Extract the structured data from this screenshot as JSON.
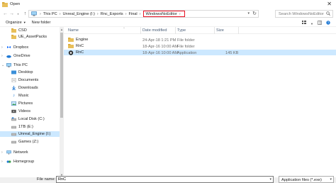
{
  "window": {
    "title": "Open"
  },
  "address": {
    "crumbs": [
      "This PC",
      "Unreal_Engine (I:)",
      "Rnc_Exports",
      "Final"
    ],
    "current": "WindowsNoEditor"
  },
  "search": {
    "placeholder": "Search WindowsNoEditor"
  },
  "toolbar": {
    "organize": "Organize",
    "new_folder": "New folder"
  },
  "sidebar": {
    "items": [
      {
        "label": "CSD",
        "icon": "folder-icon"
      },
      {
        "label": "UE_AssetPacks",
        "icon": "folder-icon"
      },
      {
        "label": "Dropbox",
        "icon": "dropbox-icon"
      },
      {
        "label": "OneDrive",
        "icon": "onedrive-icon"
      },
      {
        "label": "This PC",
        "icon": "computer-icon"
      },
      {
        "label": "Desktop",
        "icon": "desktop-icon"
      },
      {
        "label": "Documents",
        "icon": "documents-icon"
      },
      {
        "label": "Downloads",
        "icon": "downloads-icon"
      },
      {
        "label": "Music",
        "icon": "music-icon"
      },
      {
        "label": "Pictures",
        "icon": "pictures-icon"
      },
      {
        "label": "Videos",
        "icon": "videos-icon"
      },
      {
        "label": "Local Disk (C:)",
        "icon": "drive-icon"
      },
      {
        "label": "1TB (E:)",
        "icon": "drive-icon"
      },
      {
        "label": "Unreal_Engine (I:)",
        "icon": "drive-icon"
      },
      {
        "label": "Games (Z:)",
        "icon": "drive-icon"
      },
      {
        "label": "Network",
        "icon": "network-icon"
      },
      {
        "label": "Homegroup",
        "icon": "homegroup-icon"
      }
    ]
  },
  "columns": {
    "name": "Name",
    "date": "Date modified",
    "type": "Type",
    "size": "Size"
  },
  "files": [
    {
      "name": "Engine",
      "date": "24-Apr-18 1:21 PM",
      "type": "File folder",
      "size": "",
      "icon": "folder-icon"
    },
    {
      "name": "RnC",
      "date": "18-Apr-16 10:00 AM",
      "type": "File folder",
      "size": "",
      "icon": "folder-icon"
    },
    {
      "name": "RnC",
      "date": "18-Apr-16 10:00 AM",
      "type": "Application",
      "size": "145 KB",
      "icon": "app-icon"
    }
  ],
  "bottom": {
    "file_name_label": "File name:",
    "file_name_value": "RnC",
    "file_type": "Application files (*.exe)"
  },
  "colors": {
    "selection": "#cce8ff",
    "highlight_border": "#e81123",
    "folder": "#e8bf5a"
  }
}
